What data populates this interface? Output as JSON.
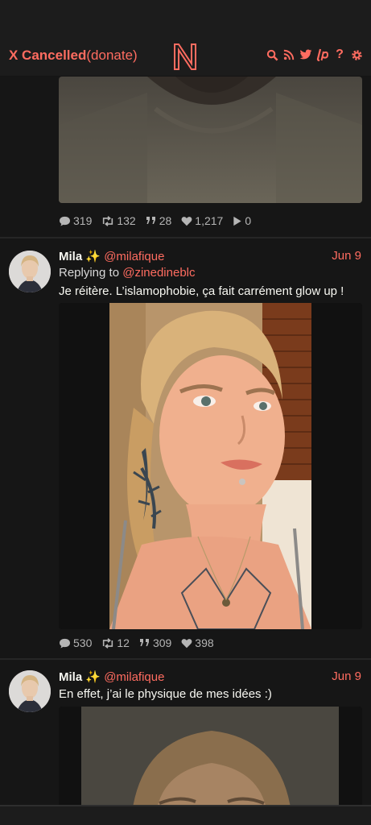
{
  "navbar": {
    "brand_main": "X Cancelled",
    "brand_sub": "(donate)",
    "icons": [
      "search-icon",
      "rss-icon",
      "twitter-icon",
      "liberapay-icon",
      "help-icon",
      "gear-icon"
    ],
    "help_glyph": "?",
    "accent": "#ff6c60"
  },
  "tweets": [
    {
      "stats": {
        "replies": "319",
        "retweets": "132",
        "quotes": "28",
        "likes": "1,217",
        "views": "0"
      }
    },
    {
      "fullname": "Mila ✨",
      "handle": "@milafique",
      "date": "Jun 9",
      "replying_prefix": "Replying to ",
      "replying_to": "@zinedineblc",
      "text": "Je réitère. L’islamophobie, ça fait carrément glow up !",
      "stats": {
        "replies": "530",
        "retweets": "12",
        "quotes": "309",
        "likes": "398"
      }
    },
    {
      "fullname": "Mila ✨",
      "handle": "@milafique",
      "date": "Jun 9",
      "text": "En effet, j’ai le physique de mes idées :)"
    }
  ]
}
